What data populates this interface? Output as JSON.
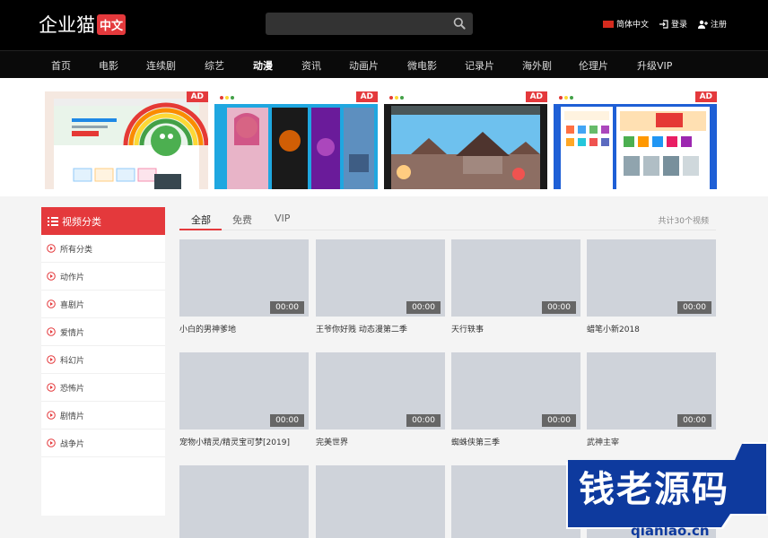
{
  "header": {
    "logo_text": "企业猫",
    "logo_badge": "中文",
    "search_placeholder": "",
    "language": "简体中文",
    "login": "登录",
    "register": "注册"
  },
  "nav": [
    "首页",
    "电影",
    "连续剧",
    "综艺",
    "动漫",
    "资讯",
    "动画片",
    "微电影",
    "记录片",
    "海外剧",
    "伦理片",
    "升级VIP"
  ],
  "ads": [
    {
      "badge": "AD"
    },
    {
      "badge": "AD"
    },
    {
      "badge": "AD"
    },
    {
      "badge": "AD"
    }
  ],
  "sidebar": {
    "title": "视频分类",
    "items": [
      "所有分类",
      "动作片",
      "喜剧片",
      "爱情片",
      "科幻片",
      "恐怖片",
      "剧情片",
      "战争片"
    ]
  },
  "tabs": {
    "items": [
      "全部",
      "免费",
      "VIP"
    ],
    "count": "共计30个视频"
  },
  "videos": [
    {
      "title": "小白的男神爹地",
      "duration": "00:00"
    },
    {
      "title": "王爷你好贱 动态漫第二季",
      "duration": "00:00"
    },
    {
      "title": "天行轶事",
      "duration": "00:00"
    },
    {
      "title": "蜡笔小新2018",
      "duration": "00:00"
    },
    {
      "title": "宠物小精灵/精灵宝可梦[2019]",
      "duration": "00:00"
    },
    {
      "title": "完美世界",
      "duration": "00:00"
    },
    {
      "title": "蜘蛛侠第三季",
      "duration": "00:00"
    },
    {
      "title": "武神主宰",
      "duration": "00:00"
    },
    {
      "title": "",
      "duration": ""
    },
    {
      "title": "",
      "duration": ""
    },
    {
      "title": "",
      "duration": ""
    },
    {
      "title": "",
      "duration": ""
    }
  ],
  "watermark": {
    "title": "钱老源码",
    "url": "qianlao.cn"
  }
}
